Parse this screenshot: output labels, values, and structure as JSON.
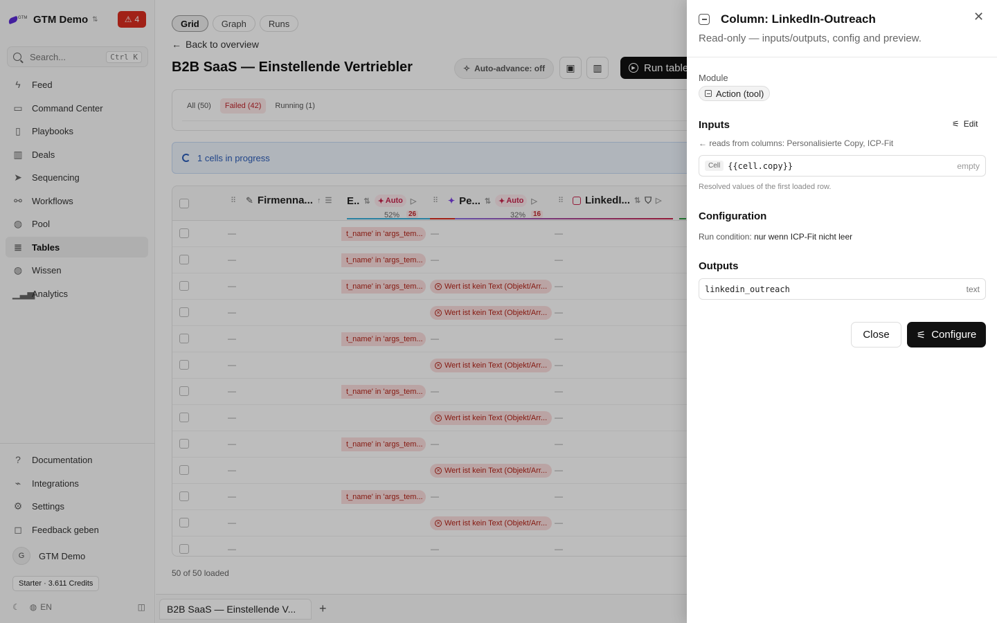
{
  "sidebar": {
    "workspace": "GTM Demo",
    "alerts_count": "4",
    "search_placeholder": "Search...",
    "search_shortcut": "Ctrl K",
    "nav": [
      {
        "label": "Feed"
      },
      {
        "label": "Command Center"
      },
      {
        "label": "Playbooks"
      },
      {
        "label": "Deals"
      },
      {
        "label": "Sequencing"
      },
      {
        "label": "Workflows"
      },
      {
        "label": "Pool"
      },
      {
        "label": "Tables"
      },
      {
        "label": "Wissen"
      },
      {
        "label": "Analytics"
      }
    ],
    "active_item": "Tables",
    "bottom_nav": [
      {
        "label": "Documentation"
      },
      {
        "label": "Integrations"
      },
      {
        "label": "Settings"
      },
      {
        "label": "Feedback geben"
      }
    ],
    "user_initial": "G",
    "user_name": "GTM Demo",
    "credits": "Starter · 3.611 Credits",
    "language": "EN"
  },
  "main": {
    "view_tabs": [
      "Grid",
      "Graph",
      "Runs"
    ],
    "active_view": "Grid",
    "back_link": "Back to overview",
    "title": "B2B SaaS — Einstellende Vertriebler",
    "auto_advance": "Auto-advance: off",
    "run_button": "Run table",
    "filters": [
      "All (50)",
      "Failed (42)",
      "Running (1)"
    ],
    "progress_banner": "1 cells in progress",
    "columns": {
      "col1": "Firmenna...",
      "col2": "E..",
      "col2_auto": "Auto",
      "col2_pct": "52%",
      "col2_count": "26",
      "col3": "Pe...",
      "col3_auto": "Auto",
      "col3_pct": "32%",
      "col3_count": "16",
      "col4": "LinkedI..."
    },
    "empty_value": "—",
    "error_args": "t_name' in 'args_tem...",
    "error_text": "Wert ist kein Text (Objekt/Arr...",
    "rows": [
      {
        "e": "args",
        "p": ""
      },
      {
        "e": "args",
        "p": ""
      },
      {
        "e": "args",
        "p": "text"
      },
      {
        "e": "",
        "p": "text"
      },
      {
        "e": "args",
        "p": ""
      },
      {
        "e": "",
        "p": "text"
      },
      {
        "e": "args",
        "p": ""
      },
      {
        "e": "",
        "p": "text"
      },
      {
        "e": "args",
        "p": ""
      },
      {
        "e": "",
        "p": "text"
      },
      {
        "e": "args",
        "p": ""
      },
      {
        "e": "",
        "p": "text"
      },
      {
        "e": "",
        "p": ""
      }
    ],
    "loaded": "50 of 50 loaded",
    "bottom_tab": "B2B SaaS — Einstellende V..."
  },
  "drawer": {
    "title": "Column: LinkedIn-Outreach",
    "subtitle": "Read-only — inputs/outputs, config and preview.",
    "module_label": "Module",
    "module_value": "Action (tool)",
    "inputs_title": "Inputs",
    "edit_label": "Edit",
    "reads_from": "← reads from columns: Personalisierte Copy, ICP-Fit",
    "input_tag": "Cell",
    "input_value": "{{cell.copy}}",
    "input_hint": "empty",
    "resolved_note": "Resolved values of the first loaded row.",
    "config_title": "Configuration",
    "run_condition_label": "Run condition:",
    "run_condition_value": "nur wenn ICP-Fit nicht leer",
    "outputs_title": "Outputs",
    "output_name": "linkedin_outreach",
    "output_type": "text",
    "close_button": "Close",
    "configure_button": "Configure"
  },
  "colors": {
    "accent": "#111111",
    "alert": "#d92d20",
    "error_bg": "#fbdede",
    "error_text": "#b42318",
    "info_bg": "#eef4fd",
    "info_text": "#2b5cb8"
  }
}
